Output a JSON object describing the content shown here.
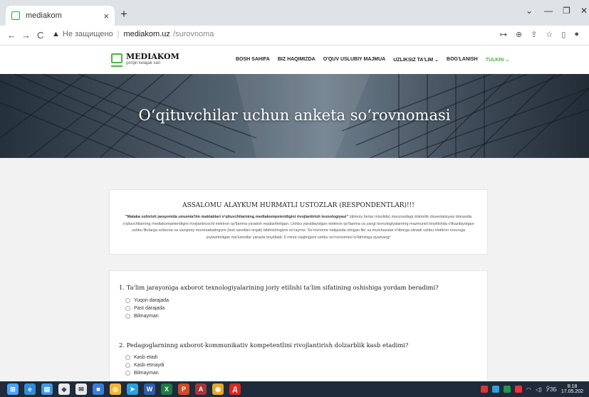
{
  "browser": {
    "tab_title": "mediakom",
    "tab_close": "×",
    "new_tab": "+",
    "window_controls": [
      "⌄",
      "—",
      "❐",
      "✕"
    ],
    "nav": {
      "back": "←",
      "forward": "→",
      "reload": "C"
    },
    "address": {
      "warning_icon": "▲",
      "insecure_label": "Не защищено",
      "host": "mediakom.uz",
      "path": "/surovnoma"
    },
    "address_icons": [
      "key-icon",
      "zoom-icon",
      "share-icon",
      "star-icon",
      "sidebar-icon",
      "profile-icon"
    ]
  },
  "site": {
    "logo_title": "MEDIAKOM",
    "logo_subtitle": "yorqin kelajak sari",
    "menu": [
      {
        "label": "BOSH SAHIFA",
        "active": false
      },
      {
        "label": "BIZ HAQIMIZDA",
        "active": false
      },
      {
        "label": "O'QUV USLUBIY MAJMUA",
        "active": false
      },
      {
        "label": "UZLIKSIZ TA'LIM ⌄",
        "active": false
      },
      {
        "label": "BOG'LANISH",
        "active": false
      },
      {
        "label": "TULKIN ⌄",
        "active": true
      }
    ],
    "accent_color": "#4bb543"
  },
  "hero": {
    "title": "O‘qituvchilar uchun anketa so‘rovnomasi"
  },
  "intro": {
    "heading": "ASSALOMU ALAYKUM HURMATLI USTOZLAR (RESPONDENTLAR)!!!",
    "bold_text": "\"Malaka oshirish jarayonida umumta'lim maktablari o'qituvchilarining mediakompetentligini rivojlantirish texnologiyasi\"",
    "body_text": " (ijtimoiy fanlar misolida) mavzusidagi doktorlik dissertatsiyasi doirasida o'qituvchilarning mediakompetentligini rivojlantiruvchi elektron qo'llanma yaratish rejalashtirilgan. Ushbu yaratilayotgan elektron qo'llanma va yangi texnologiyalarning mazmunini boyitishda o'tkazilayotgan ushbu fikrlarga xolisona va vazqoniy munosabatingizni (test savollari orqali) bildirishingizni so'raymiz. So'rovnome natijasida olingan fikr va mulohazalar e'tiborga olinadi ushbu elektron resursga joylashtirilgan ma'lumotlar yanada boyitiladi. 5 minut vaqtingizni ushbu so'rovnomani to'ldirishga ayamang!"
  },
  "questions": [
    {
      "text": "1. Ta'lim jarayoniga axborot texnologiyalarining joriy etilishi ta'lim sifatining oshishiga yordam beradimi?",
      "options": [
        "Yuqori darajada",
        "Past darajada",
        "Bilmayman"
      ]
    },
    {
      "text": "2. Pedagoglarninng axborot-kommunikativ kompetentlini rivojlantirish dolzarblik kasb etadimi?",
      "options": [
        "Kasb etadi",
        "Kasb etmaydi",
        "Bilmayman"
      ]
    }
  ],
  "taskbar": {
    "apps": [
      {
        "name": "windows-icon",
        "color": "#4aa3ff",
        "glyph": "⊞"
      },
      {
        "name": "edge-icon",
        "color": "#2f8fd8",
        "glyph": "e"
      },
      {
        "name": "explorer-icon",
        "color": "#3c9be6",
        "glyph": "▤"
      },
      {
        "name": "store-icon",
        "color": "#e8e8e8",
        "glyph": "◈"
      },
      {
        "name": "mail-icon",
        "color": "#e8e8e8",
        "glyph": "✉"
      },
      {
        "name": "app-icon",
        "color": "#3b7ddd",
        "glyph": "■"
      },
      {
        "name": "chrome-alt-icon",
        "color": "#f2b632",
        "glyph": "◎"
      },
      {
        "name": "telegram-icon",
        "color": "#2aa1de",
        "glyph": "➤"
      },
      {
        "name": "word-icon",
        "color": "#2b5eb0",
        "glyph": "W"
      },
      {
        "name": "excel-icon",
        "color": "#1d7a45",
        "glyph": "X"
      },
      {
        "name": "powerpoint-icon",
        "color": "#d04a24",
        "glyph": "P"
      },
      {
        "name": "access-icon",
        "color": "#a4373a",
        "glyph": "A"
      },
      {
        "name": "chrome-icon",
        "color": "#e6a82a",
        "glyph": "◉"
      },
      {
        "name": "acrobat-icon",
        "color": "#d8281f",
        "glyph": "Д"
      }
    ],
    "tray_lang": "ЎЗБ",
    "time": "8:18",
    "date": "17.05.202"
  }
}
